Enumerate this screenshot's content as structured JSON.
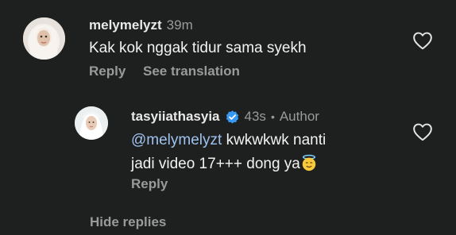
{
  "comments": [
    {
      "username": "melymelyzt",
      "time": "39m",
      "text": "Kak kok nggak tidur sama syekh",
      "actions": {
        "reply": "Reply",
        "translate": "See translation"
      },
      "avatar_icon": "user-avatar"
    }
  ],
  "reply": {
    "username": "tasyiiathasyia",
    "time": "43s",
    "role": "Author",
    "mention": "@melymelyzt",
    "text_line1_rest": " kwkwkwk nanti",
    "text_line2": "jadi video 17+++ dong ya",
    "emoji": "innocent-face-emoji",
    "actions": {
      "reply": "Reply"
    },
    "verified_icon": "verified-badge-icon",
    "verified_color": "#3897f0"
  },
  "hide_replies": "Hide replies",
  "colors": {
    "background": "#1e1f1f",
    "mention": "#9fc3ee",
    "muted": "#9a9a9a"
  }
}
